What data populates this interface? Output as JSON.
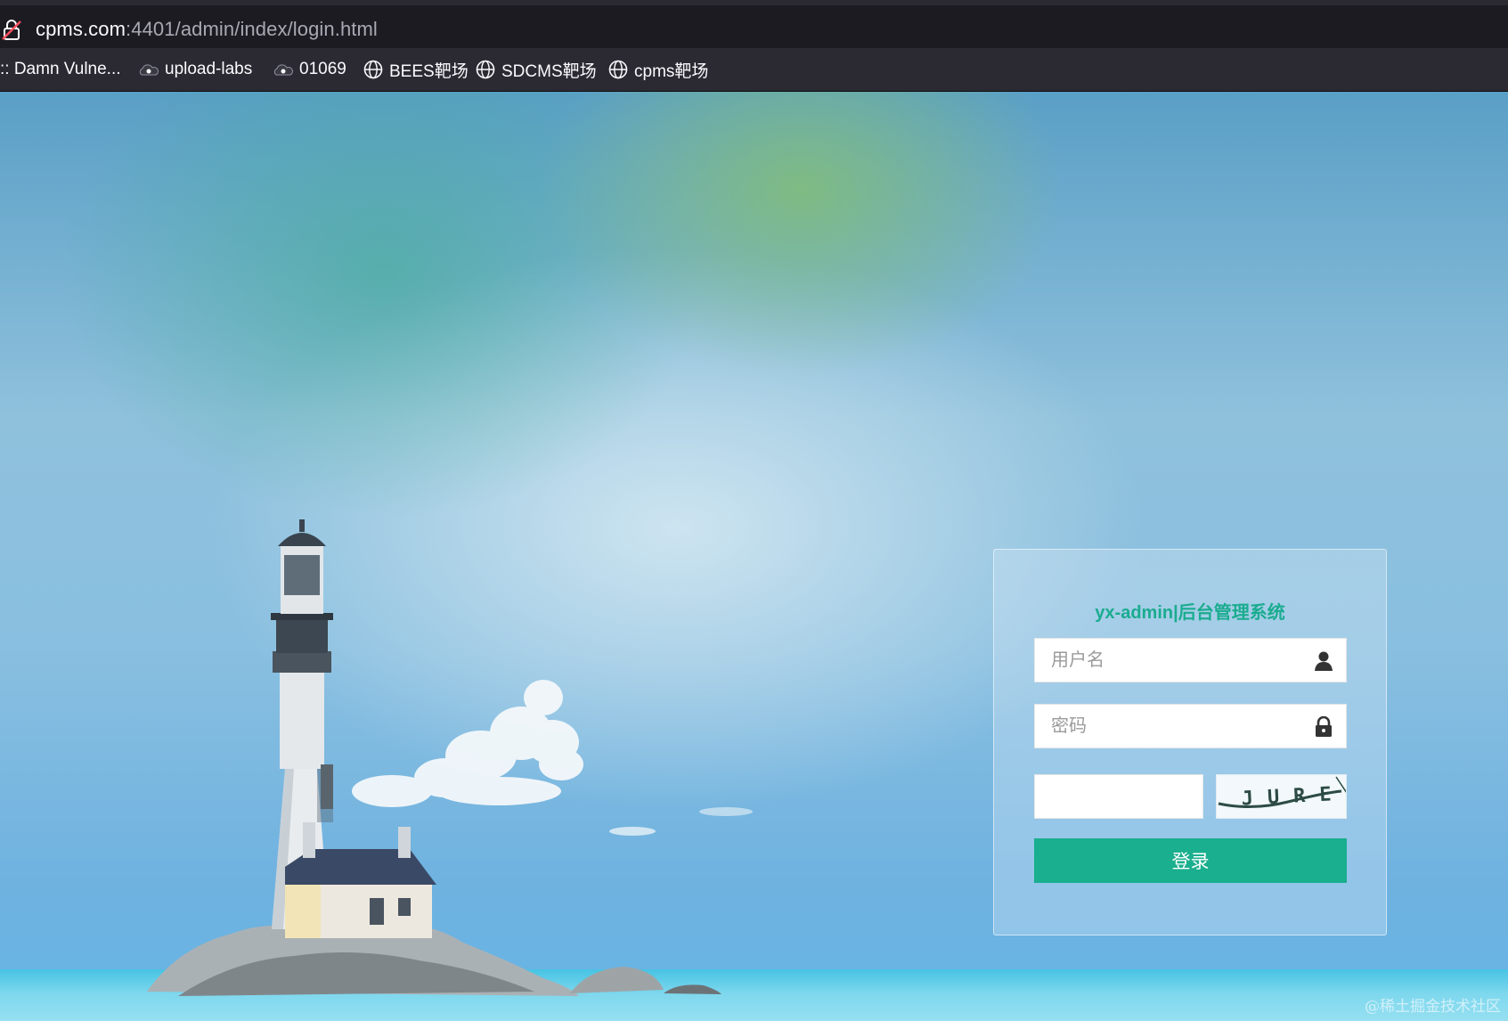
{
  "browser": {
    "url_host": "cpms.com",
    "url_rest": ":4401/admin/index/login.html",
    "bookmarks": [
      {
        "label": ":: Damn Vulne...",
        "icon": "none"
      },
      {
        "label": "upload-labs",
        "icon": "cloud-icon"
      },
      {
        "label": "01069",
        "icon": "cloud-icon"
      },
      {
        "label": "BEES靶场",
        "icon": "globe-icon"
      },
      {
        "label": "SDCMS靶场",
        "icon": "globe-icon"
      },
      {
        "label": "cpms靶场",
        "icon": "globe-icon"
      }
    ]
  },
  "login": {
    "title": "yx-admin|后台管理系统",
    "username_placeholder": "用户名",
    "password_placeholder": "密码",
    "captcha_value": "",
    "captcha_text": "JURE",
    "submit_label": "登录"
  },
  "watermark": "@稀土掘金技术社区",
  "colors": {
    "accent": "#1aaf8e",
    "title": "#1aac8f",
    "browser_bg": "#1c1b22"
  }
}
